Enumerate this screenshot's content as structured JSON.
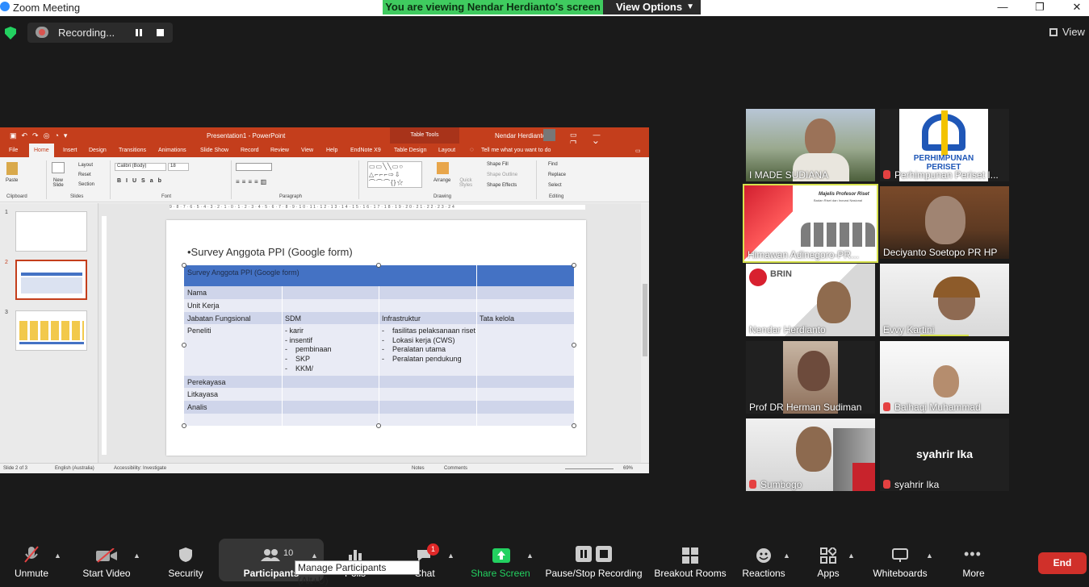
{
  "window": {
    "title": "Zoom Meeting",
    "minimize": "—",
    "maximize": "❐",
    "close": "✕"
  },
  "banner": {
    "viewing": "You are viewing Nendar Herdianto's screen",
    "view_options": "View Options"
  },
  "recording": {
    "label": "Recording..."
  },
  "view_button": "View",
  "ppt": {
    "title": "Presentation1 - PowerPoint",
    "table_tools": "Table Tools",
    "user": "Nendar Herdianto",
    "tabs": [
      "File",
      "Home",
      "Insert",
      "Design",
      "Transitions",
      "Animations",
      "Slide Show",
      "Record",
      "Review",
      "View",
      "Help",
      "EndNote X9",
      "Table Design",
      "Layout"
    ],
    "tell_me": "Tell me what you want to do",
    "ribbon": {
      "paste": "Paste",
      "new_slide": "New Slide",
      "layout": "Layout",
      "reset": "Reset",
      "section": "Section",
      "font": "Calibri (Body)",
      "font_size": "18",
      "arrange": "Arrange",
      "quick_styles": "Quick Styles",
      "shape_fill": "Shape Fill",
      "shape_outline": "Shape Outline",
      "shape_effects": "Shape Effects",
      "find": "Find",
      "replace": "Replace",
      "select": "Select",
      "groups": [
        "Clipboard",
        "Slides",
        "Font",
        "Paragraph",
        "Drawing",
        "Editing"
      ]
    },
    "slide_numbers": [
      "1",
      "2",
      "3"
    ],
    "slide": {
      "bullet": "•Survey Anggota PPI (Google form)",
      "table_header": "Survey Anggota PPI (Google form)",
      "rows": [
        {
          "c1": "Nama",
          "c2": "",
          "c3": "",
          "c4": ""
        },
        {
          "c1": "Unit Kerja",
          "c2": "",
          "c3": "",
          "c4": ""
        },
        {
          "c1": "Jabatan Fungsional",
          "c2": "SDM",
          "c3": "Infrastruktur",
          "c4": "Tata kelola"
        },
        {
          "c1": "Peneliti",
          "c2": "- karir\n- insentif\n-    pembinaan\n-    SKP\n-    KKM/",
          "c3": "-    fasilitas pelaksanaan riset\n-    Lokasi kerja (CWS)\n-    Peralatan utama\n-    Peralatan pendukung",
          "c4": ""
        },
        {
          "c1": "Perekayasa",
          "c2": "",
          "c3": "",
          "c4": ""
        },
        {
          "c1": "Litkayasa",
          "c2": "",
          "c3": "",
          "c4": ""
        },
        {
          "c1": "Analis",
          "c2": "",
          "c3": "",
          "c4": ""
        },
        {
          "c1": "",
          "c2": "",
          "c3": "",
          "c4": ""
        }
      ]
    },
    "status": {
      "slide": "Slide 2 of 3",
      "language": "English (Australia)",
      "accessibility": "Accessibility: Investigate",
      "notes": "Notes",
      "comments": "Comments",
      "zoom": "69%"
    }
  },
  "participants": [
    {
      "name": "I MADE SUDIANA",
      "muted": false
    },
    {
      "name": "Perhimpunan Periset I...",
      "muted": true
    },
    {
      "name": "Himawan Adinegoro-PR...",
      "muted": false
    },
    {
      "name": "Deciyanto Soetopo PR HP",
      "muted": false
    },
    {
      "name": "Nendar Herdianto",
      "muted": false
    },
    {
      "name": "Evvy Kartini",
      "muted": false
    },
    {
      "name": "Prof DR Herman Sudiman",
      "muted": false
    },
    {
      "name": "Baihaqi Muhammad",
      "muted": true
    },
    {
      "name": "Sumbogo",
      "muted": true
    },
    {
      "name": "syahrir Ika",
      "muted": true
    }
  ],
  "tile_texts": {
    "perhimpunan_logo": "PERHIMPUNAN PERISET",
    "majelis": "Majelis Profesor Riset",
    "majelis_sub": "Badan Riset dan Inovasi Nasional",
    "brin": "BRIN",
    "syahrir_center": "syahrir Ika"
  },
  "toolbar": {
    "unmute": "Unmute",
    "start_video": "Start Video",
    "security": "Security",
    "participants": "Participants",
    "participants_count": "10",
    "polls": "Polls",
    "chat": "Chat",
    "chat_badge": "1",
    "share_screen": "Share Screen",
    "pause_stop": "Pause/Stop Recording",
    "breakout": "Breakout Rooms",
    "reactions": "Reactions",
    "apps": "Apps",
    "whiteboards": "Whiteboards",
    "more": "More",
    "end": "End",
    "tooltip": "Manage Participants (Alt+U)"
  },
  "colors": {
    "ppt_accent": "#c43e1c",
    "table_header": "#4472c4",
    "share_green": "#23d160",
    "end_red": "#d0302a",
    "speaking": "#d6e14d"
  }
}
